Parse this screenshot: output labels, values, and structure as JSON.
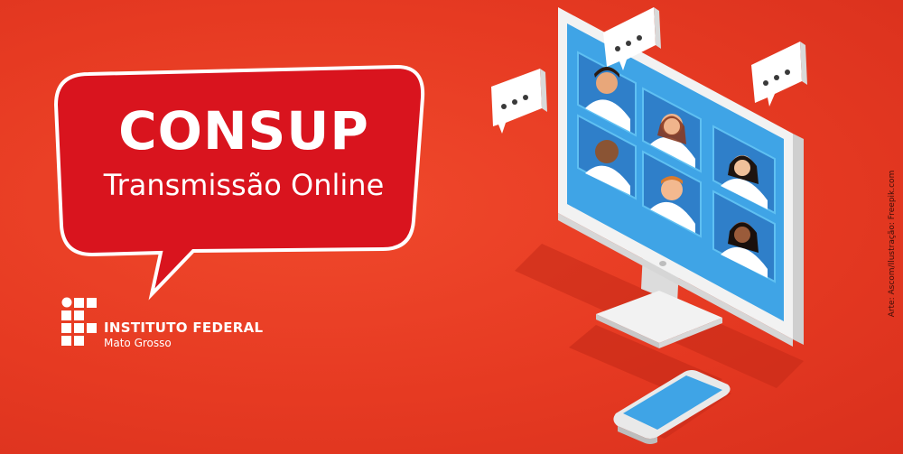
{
  "bubble": {
    "title": "CONSUP",
    "subtitle": "Transmissão Online"
  },
  "institution": {
    "name": "INSTITUTO FEDERAL",
    "campus": "Mato Grosso"
  },
  "credit": "Arte: Ascom/Ilustração: Freepik.com",
  "icons": [
    "speech-bubble-icon",
    "ellipsis-icon",
    "monitor-icon",
    "smartphone-icon",
    "if-logo-icon"
  ],
  "colors": {
    "background": "#e63a22",
    "bubble_red": "#d9141e",
    "bubble_border": "#ffffff",
    "screen_blue": "#3fa4e6",
    "tile_blue": "#2f7fc9",
    "device_white": "#f2f2f2",
    "shadow": "#c42a17"
  }
}
